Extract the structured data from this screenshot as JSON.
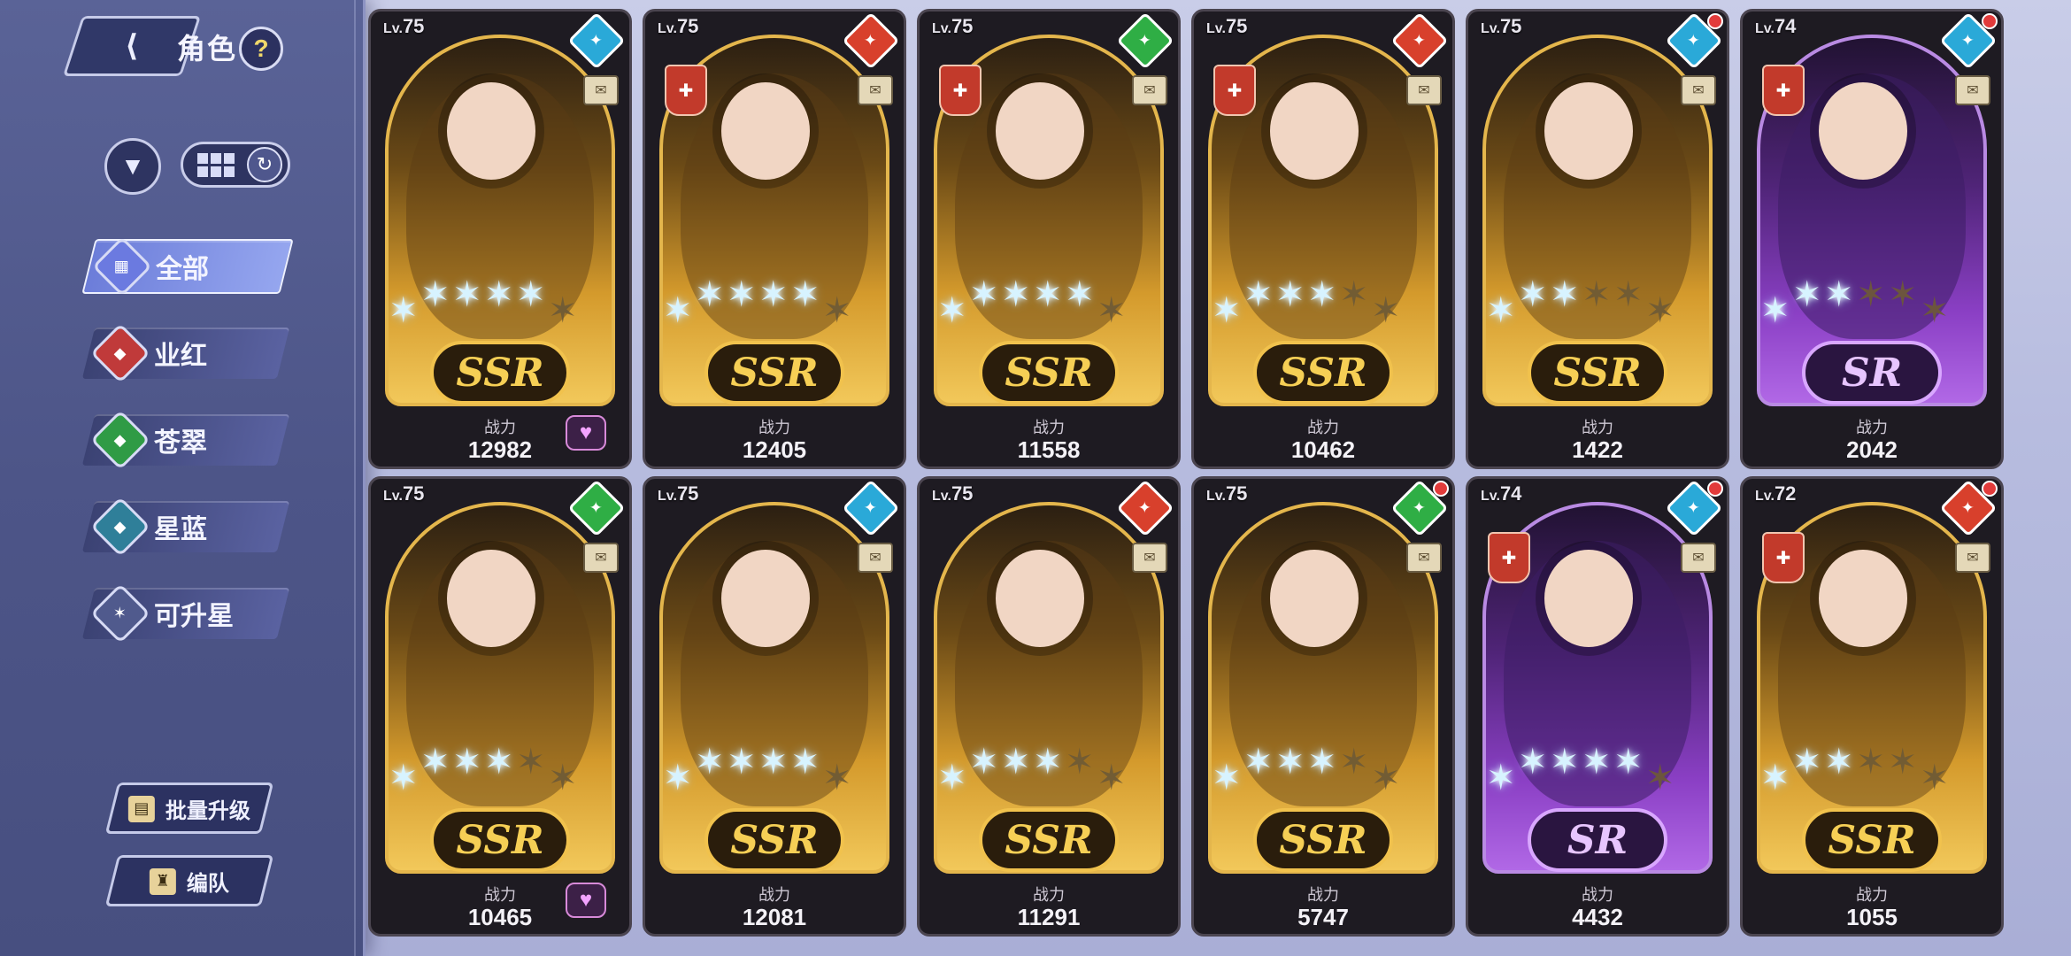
{
  "header": {
    "title": "角色",
    "back_icon": "back-arrow-icon",
    "help_label": "?"
  },
  "toolbar": {
    "filter_icon": "filter-funnel-icon",
    "grid_icon": "grid-view-icon",
    "refresh_icon": "refresh-icon"
  },
  "categories": [
    {
      "label": "全部",
      "icon": "all-icon",
      "color": "#6b7ae0",
      "active": true
    },
    {
      "label": "业红",
      "icon": "red-diamond-icon",
      "color": "#c03a3a",
      "active": false
    },
    {
      "label": "苍翠",
      "icon": "green-diamond-icon",
      "color": "#2f9b45",
      "active": false
    },
    {
      "label": "星蓝",
      "icon": "teal-diamond-icon",
      "color": "#2f7f99",
      "active": false
    },
    {
      "label": "可升星",
      "icon": "upgrade-star-icon",
      "color": "#505a8d",
      "active": false
    }
  ],
  "actions": {
    "bulk_upgrade": "批量升级",
    "team": "编队"
  },
  "power_label": "战力",
  "cards": [
    {
      "lv": "75",
      "rarity": "SSR",
      "power": "12982",
      "elem_color": "#2aa9d8",
      "type_badge": false,
      "heart": true,
      "notif": false,
      "lit": 5,
      "total": 6
    },
    {
      "lv": "75",
      "rarity": "SSR",
      "power": "12405",
      "elem_color": "#d8402c",
      "type_badge": true,
      "heart": false,
      "notif": false,
      "lit": 5,
      "total": 6
    },
    {
      "lv": "75",
      "rarity": "SSR",
      "power": "11558",
      "elem_color": "#2fae45",
      "type_badge": true,
      "heart": false,
      "notif": false,
      "lit": 5,
      "total": 6
    },
    {
      "lv": "75",
      "rarity": "SSR",
      "power": "10462",
      "elem_color": "#d8402c",
      "type_badge": true,
      "heart": false,
      "notif": false,
      "lit": 4,
      "total": 6
    },
    {
      "lv": "75",
      "rarity": "SSR",
      "power": "1422",
      "elem_color": "#2aa9d8",
      "type_badge": false,
      "heart": false,
      "notif": true,
      "lit": 3,
      "total": 6
    },
    {
      "lv": "74",
      "rarity": "SR",
      "power": "2042",
      "elem_color": "#2aa9d8",
      "type_badge": true,
      "heart": false,
      "notif": true,
      "lit": 3,
      "total": 6
    },
    {
      "lv": "75",
      "rarity": "SSR",
      "power": "10465",
      "elem_color": "#2fae45",
      "type_badge": false,
      "heart": true,
      "notif": false,
      "lit": 4,
      "total": 6
    },
    {
      "lv": "75",
      "rarity": "SSR",
      "power": "12081",
      "elem_color": "#2aa9d8",
      "type_badge": false,
      "heart": false,
      "notif": false,
      "lit": 5,
      "total": 6
    },
    {
      "lv": "75",
      "rarity": "SSR",
      "power": "11291",
      "elem_color": "#d8402c",
      "type_badge": false,
      "heart": false,
      "notif": false,
      "lit": 4,
      "total": 6
    },
    {
      "lv": "75",
      "rarity": "SSR",
      "power": "5747",
      "elem_color": "#2fae45",
      "type_badge": false,
      "heart": false,
      "notif": true,
      "lit": 4,
      "total": 6
    },
    {
      "lv": "74",
      "rarity": "SR",
      "power": "4432",
      "elem_color": "#2aa9d8",
      "type_badge": true,
      "heart": false,
      "notif": true,
      "lit": 5,
      "total": 6
    },
    {
      "lv": "72",
      "rarity": "SSR",
      "power": "1055",
      "elem_color": "#d8402c",
      "type_badge": true,
      "heart": false,
      "notif": true,
      "lit": 3,
      "total": 6
    }
  ]
}
